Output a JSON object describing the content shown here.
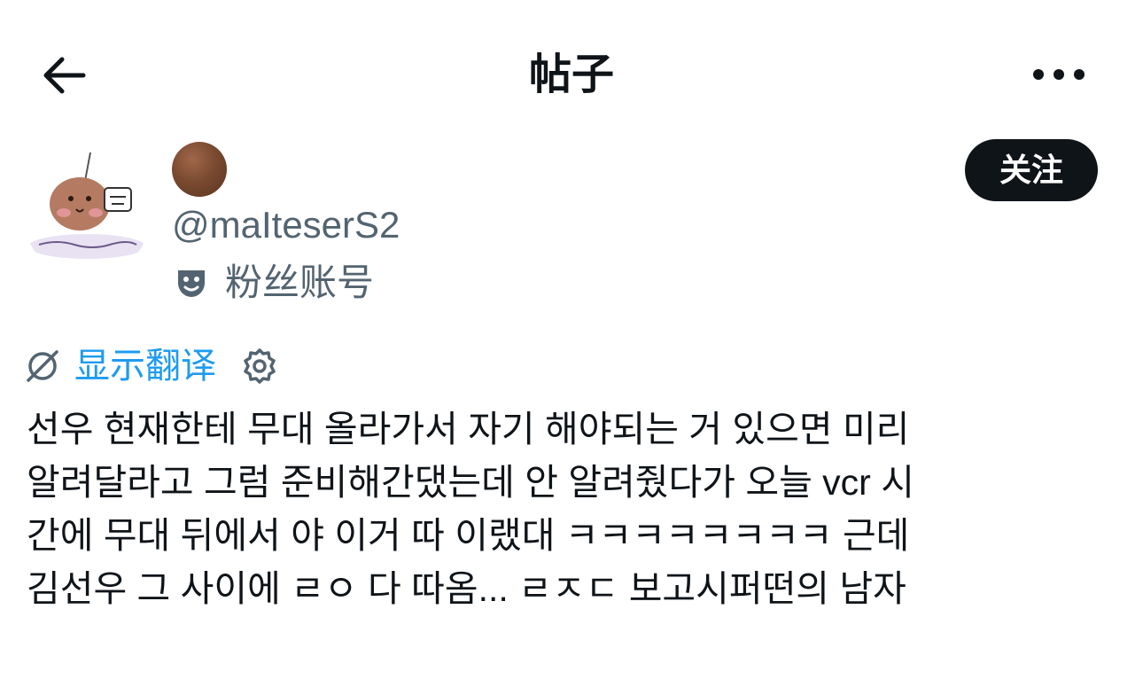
{
  "header": {
    "title": "帖子",
    "back_icon": "arrow-left-icon",
    "more_icon": "more-horizontal-icon"
  },
  "author": {
    "avatar_icon": "profile-avatar",
    "display_name_emoji": "brown-circle-emoji",
    "handle": "@maIteserS2",
    "badge_icon": "theater-mask-icon",
    "badge_label": "粉丝账号",
    "follow_label": "关注"
  },
  "translate": {
    "icon": "translate-off-icon",
    "label": "显示翻译",
    "settings_icon": "gear-icon"
  },
  "post": {
    "lines": [
      "선우 현재한테 무대 올라가서 자기 해야되는 거 있으면 미리",
      "알려달라고 그럼 준비해간댔는데 안 알려줬다가 오늘 vcr 시",
      "간에 무대 뒤에서 야 이거 따 이랬대 ㅋㅋㅋㅋㅋㅋㅋㅋ 근데",
      "김선우 그 사이에 ㄹㅇ 다 따옴... ㄹㅈㄷ 보고시퍼떤의 남자"
    ]
  },
  "colors": {
    "text": "#0f1419",
    "secondary": "#536471",
    "accent": "#1d9bf0",
    "button_bg": "#0f1419"
  }
}
